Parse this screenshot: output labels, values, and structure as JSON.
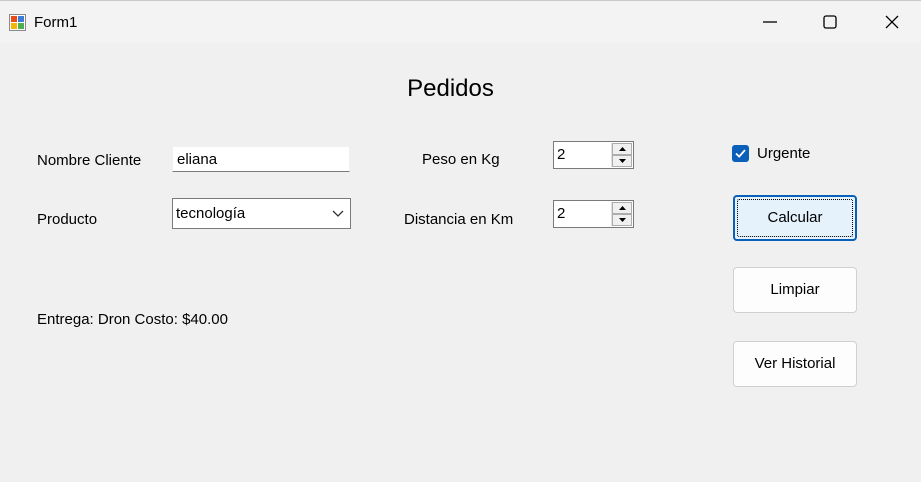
{
  "window": {
    "title": "Form1",
    "icons": {
      "app": "winforms-app-icon",
      "minimize": "minimize-icon",
      "maximize": "maximize-icon",
      "close": "close-icon"
    }
  },
  "form": {
    "heading": "Pedidos",
    "nombre_cliente": {
      "label": "Nombre Cliente",
      "value": "eliana"
    },
    "producto": {
      "label": "Producto",
      "selected": "tecnología"
    },
    "peso": {
      "label": "Peso en Kg",
      "value": "2"
    },
    "distancia": {
      "label": "Distancia en Km",
      "value": "2"
    },
    "urgente": {
      "label": "Urgente",
      "checked": true
    },
    "result_text": "Entrega: Dron Costo: $40.00"
  },
  "buttons": {
    "calcular": "Calcular",
    "limpiar": "Limpiar",
    "ver_historial": "Ver Historial"
  },
  "colors": {
    "accent": "#0a5fb8",
    "background": "#f0f0f0"
  }
}
